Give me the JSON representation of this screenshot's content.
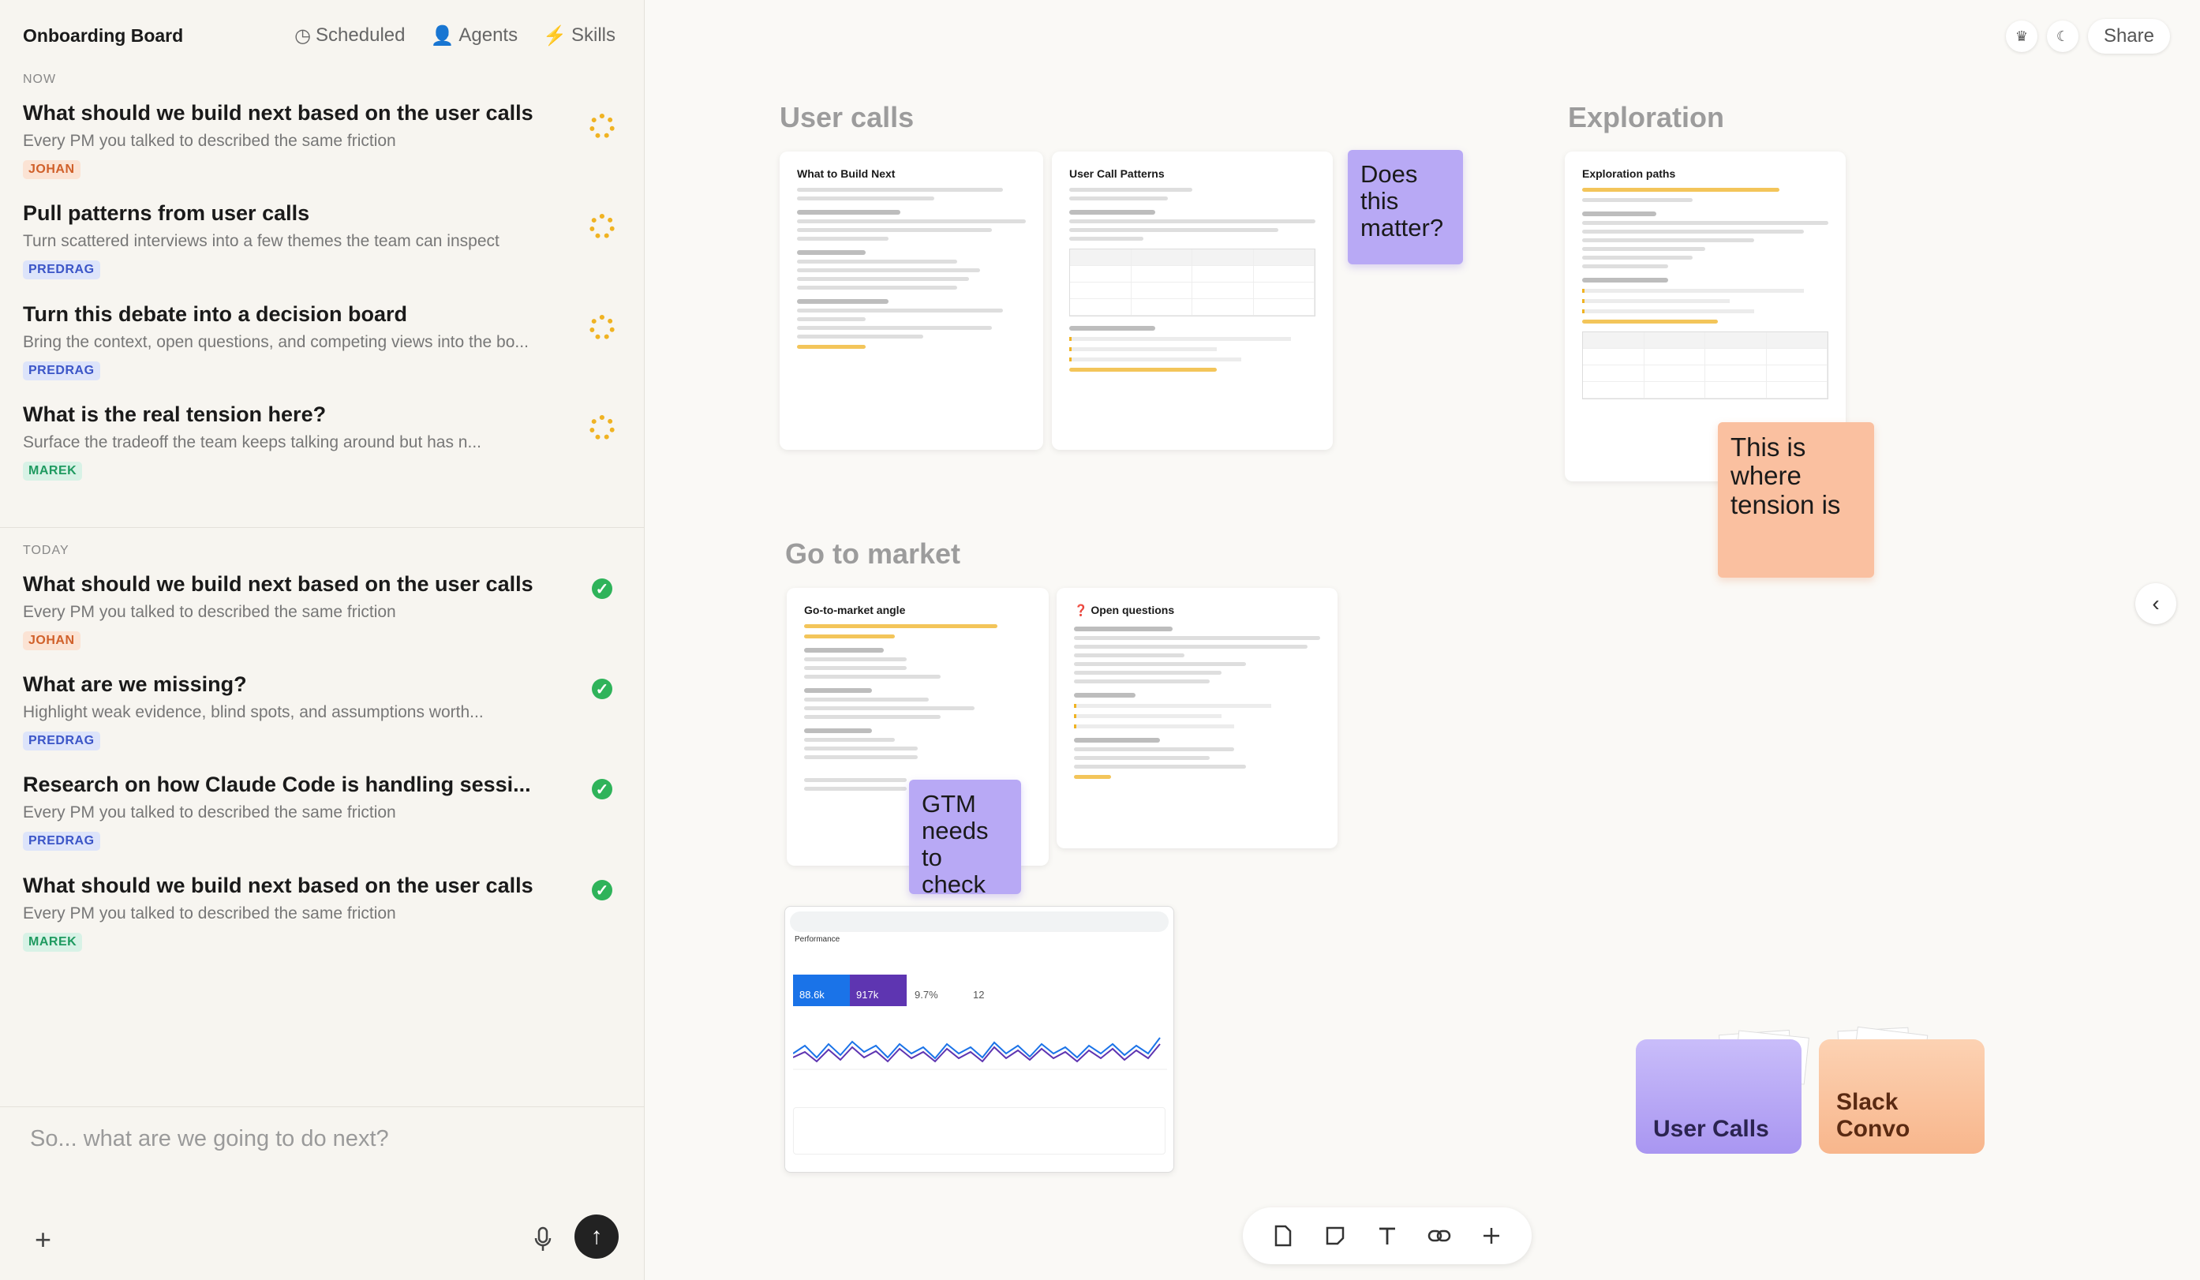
{
  "sidebar": {
    "title": "Onboarding Board",
    "nav": {
      "scheduled": "Scheduled",
      "agents": "Agents",
      "skills": "Skills"
    },
    "sections": {
      "now": "NOW",
      "today": "TODAY"
    },
    "now_tasks": [
      {
        "title": "What should we build next based on the user calls",
        "subtitle": "Every PM you talked to described the same friction",
        "owner": "JOHAN"
      },
      {
        "title": "Pull patterns from user calls",
        "subtitle": "Turn scattered interviews into a few themes the team can inspect",
        "owner": "PREDRAG"
      },
      {
        "title": "Turn this debate into a decision board",
        "subtitle": "Bring the context, open questions, and competing views into the bo...",
        "owner": "PREDRAG"
      },
      {
        "title": "What is the real tension here?",
        "subtitle": "Surface the tradeoff the team keeps talking around but has n...",
        "owner": "MAREK"
      }
    ],
    "today_tasks": [
      {
        "title": "What should we build next based on the user calls",
        "subtitle": "Every PM you talked to described the same friction",
        "owner": "JOHAN"
      },
      {
        "title": "What are we missing?",
        "subtitle": "Highlight weak evidence, blind spots, and assumptions worth...",
        "owner": "PREDRAG"
      },
      {
        "title": "Research on how Claude Code is handling sessi...",
        "subtitle": "Every PM you talked to described the same friction",
        "owner": "PREDRAG"
      },
      {
        "title": "What should we build next based on the user calls",
        "subtitle": "Every PM you talked to described the same friction",
        "owner": "MAREK"
      }
    ],
    "composer_placeholder": "So... what are we going to do next?"
  },
  "canvas": {
    "sections": {
      "user_calls": "User calls",
      "exploration": "Exploration",
      "go_to_market": "Go to market"
    },
    "cards": {
      "what_to_build": "What to Build Next",
      "user_call_patterns": "User Call Patterns",
      "exploration_paths": "Exploration paths",
      "gtm_angle": "Go-to-market angle",
      "open_questions": "❓ Open questions"
    },
    "stickies": {
      "matter": "Does this matter?",
      "tension": "This is where tension is",
      "gtm": "GTM needs to check"
    },
    "folders": {
      "user_calls": "User Calls",
      "slack": "Slack Convo"
    },
    "dashboard": {
      "metric1": "88.6k",
      "metric2": "917k",
      "metric3": "9.7%",
      "metric4": "12",
      "label": "Performance"
    }
  },
  "topbar": {
    "share": "Share"
  },
  "colors": {
    "accent_yellow": "#f0b323",
    "check_green": "#2fb35a",
    "sticky_purple": "#b8a9f5",
    "sticky_orange": "#fac0a0"
  }
}
